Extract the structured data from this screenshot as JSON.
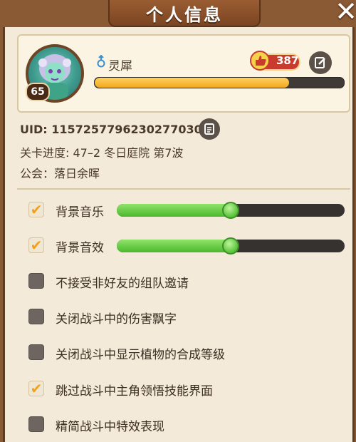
{
  "header": {
    "title": "个人信息",
    "close_label": "✕"
  },
  "profile": {
    "level": "65",
    "name": "灵犀",
    "likes": "387",
    "exp_fraction": 0.78,
    "uid_label": "UID: 1157257796230277030",
    "progress_label": "关卡进度: 47–2  冬日庭院 第7波",
    "guild_label": "公会：落日余晖"
  },
  "colors": {
    "accent": "#f2a21a",
    "slider_green": "#4bb82c",
    "panel": "#f3ead9"
  },
  "settings": [
    {
      "label": "背景音乐",
      "checked": true,
      "slider": 0.5
    },
    {
      "label": "背景音效",
      "checked": true,
      "slider": 0.5
    },
    {
      "label": "不接受非好友的组队邀请",
      "checked": false
    },
    {
      "label": "关闭战斗中的伤害飘字",
      "checked": false
    },
    {
      "label": "关闭战斗中显示植物的合成等级",
      "checked": false
    },
    {
      "label": "跳过战斗中主角领悟技能界面",
      "checked": true
    },
    {
      "label": "精简战斗中特效表现",
      "checked": false
    }
  ]
}
